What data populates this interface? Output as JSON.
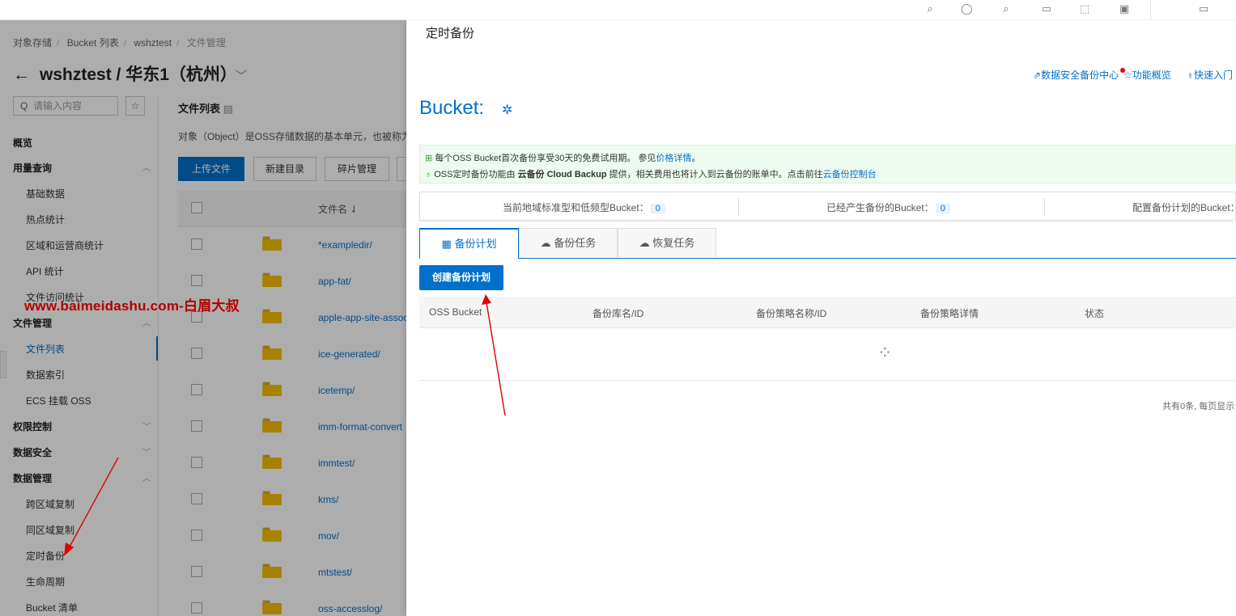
{
  "topbar_icons": [
    "search-icon",
    "help-icon",
    "search-icon",
    "doc-icon",
    "expand-icon",
    "clipboard-icon",
    "window-icon"
  ],
  "console": {
    "breadcrumb": [
      "对象存储",
      "Bucket 列表",
      "wshztest",
      "文件管理"
    ],
    "bucket_title": "wshztest / 华东1（杭州）",
    "search_placeholder": "请输入内容",
    "nav": [
      {
        "label": "概览",
        "type": "group"
      },
      {
        "label": "用量查询",
        "type": "group",
        "caret": "up"
      },
      {
        "label": "基础数据",
        "type": "sub"
      },
      {
        "label": "热点统计",
        "type": "sub"
      },
      {
        "label": "区域和运营商统计",
        "type": "sub"
      },
      {
        "label": "API 统计",
        "type": "sub"
      },
      {
        "label": "文件访问统计",
        "type": "sub"
      },
      {
        "label": "文件管理",
        "type": "group",
        "caret": "up"
      },
      {
        "label": "文件列表",
        "type": "sub",
        "active": true
      },
      {
        "label": "数据索引",
        "type": "sub"
      },
      {
        "label": "ECS 挂载 OSS",
        "type": "sub"
      },
      {
        "label": "权限控制",
        "type": "group",
        "caret": "down"
      },
      {
        "label": "数据安全",
        "type": "group",
        "caret": "down"
      },
      {
        "label": "数据管理",
        "type": "group",
        "caret": "up"
      },
      {
        "label": "跨区域复制",
        "type": "sub"
      },
      {
        "label": "同区域复制",
        "type": "sub"
      },
      {
        "label": "定时备份",
        "type": "sub"
      },
      {
        "label": "生命周期",
        "type": "sub"
      },
      {
        "label": "Bucket 清单",
        "type": "sub"
      }
    ],
    "file_list_title": "文件列表",
    "file_list_desc": "对象（Object）是OSS存储数据的基本单元，也被称为",
    "buttons": {
      "upload": "上传文件",
      "new_dir": "新建目录",
      "fragments": "碎片管理"
    },
    "col_filename": "文件名 ⇃",
    "files": [
      "*exampledir/",
      "app-fat/",
      "apple-app-site-assoc",
      "ice-generated/",
      "icetemp/",
      "imm-format-convert",
      "immtest/",
      "kms/",
      "mov/",
      "mtstest/",
      "oss-accesslog/"
    ]
  },
  "watermark": "www.baimeidashu.com-白眉大叔",
  "panel": {
    "title": "定时备份",
    "links": {
      "data_security": "数据安全备份中心",
      "features": "功能概览",
      "quick_start": "快速入门"
    },
    "bucket_label": "Bucket:",
    "notice_line1": {
      "text": "每个OSS Bucket首次备份享受30天的免费试用期。 参见",
      "link": "价格详情",
      "end": "。"
    },
    "notice_line2": {
      "pre": "OSS定时备份功能由 ",
      "bold": "云备份 Cloud Backup",
      "mid": " 提供，相关费用也将计入到云备份的账单中。点击前往",
      "link": "云备份控制台"
    },
    "stats": [
      {
        "label": "当前地域标准型和低频型Bucket：",
        "value": "0"
      },
      {
        "label": "已经产生备份的Bucket：",
        "value": "0"
      },
      {
        "label": "配置备份计划的Bucket：",
        "value": ""
      }
    ],
    "tabs": [
      {
        "label": "备份计划",
        "icon": "calendar-icon",
        "active": true
      },
      {
        "label": "备份任务",
        "icon": "cloud-upload-icon",
        "active": false
      },
      {
        "label": "恢复任务",
        "icon": "cloud-download-icon",
        "active": false
      }
    ],
    "create_button": "创建备份计划",
    "columns": [
      "OSS Bucket",
      "备份库名/ID",
      "备份策略名称/ID",
      "备份策略详情",
      "状态"
    ],
    "pager": "共有0条, 每页显示"
  }
}
